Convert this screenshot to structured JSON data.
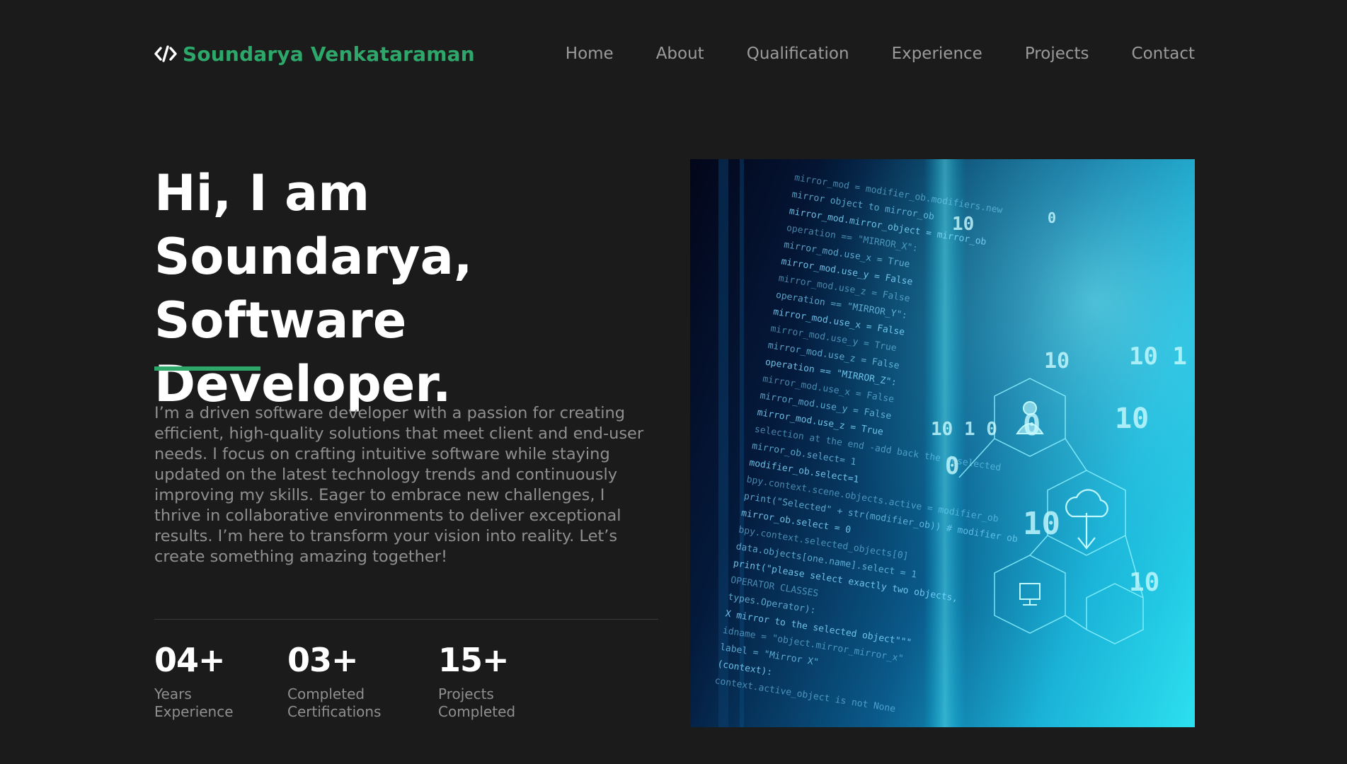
{
  "header": {
    "logo_icon": "code-brackets-icon",
    "logo_text": "Soundarya Venkataraman",
    "nav": [
      {
        "label": "Home"
      },
      {
        "label": "About"
      },
      {
        "label": "Qualification"
      },
      {
        "label": "Experience"
      },
      {
        "label": "Projects"
      },
      {
        "label": "Contact"
      }
    ]
  },
  "hero": {
    "title_lines": [
      "Hi, I am Soundarya,",
      "Software",
      "Developer."
    ],
    "description": "I’m a driven software developer with a passion for creating efficient, high-quality solutions that meet client and end-user needs. I focus on crafting intuitive software while staying updated on the latest technology trends and continuously improving my skills. Eager to embrace new challenges, I thrive in collaborative environments to deliver exceptional results. I’m here to transform your vision into reality. Let’s create something amazing together!",
    "stats": [
      {
        "number": "04+",
        "label_lines": [
          "Years",
          "Experience"
        ]
      },
      {
        "number": "03+",
        "label_lines": [
          "Completed",
          "Certifications"
        ]
      },
      {
        "number": "15+",
        "label_lines": [
          "Projects",
          "Completed"
        ]
      }
    ],
    "image": {
      "code_lines": [
        "mirror_mod = modifier_ob.modifiers.new",
        "mirror object to mirror_ob",
        "mirror_mod.mirror_object = mirror_ob",
        "operation == \"MIRROR_X\":",
        "mirror_mod.use_x = True",
        "mirror_mod.use_y = False",
        "mirror_mod.use_z = False",
        "operation == \"MIRROR_Y\":",
        "mirror_mod.use_x = False",
        "mirror_mod.use_y = True",
        "mirror_mod.use_z = False",
        "operation == \"MIRROR_Z\":",
        "mirror_mod.use_x = False",
        "mirror_mod.use_y = False",
        "mirror_mod.use_z = True",
        "selection at the end -add back the deselected",
        "mirror_ob.select= 1",
        "modifier_ob.select=1",
        "bpy.context.scene.objects.active = modifier_ob",
        "print(\"Selected\" + str(modifier_ob)) # modifier ob",
        "mirror_ob.select = 0",
        "bpy.context.selected_objects[0]",
        "data.objects[one.name].select = 1",
        "print(\"please select exactly two objects,",
        "OPERATOR CLASSES",
        "types.Operator):",
        "X mirror to the selected object\"\"\"",
        "idname = \"object.mirror_mirror_x\"",
        "label = \"Mirror X\"",
        "(context):",
        "context.active_object is not None"
      ],
      "binary_glyphs": [
        "10",
        "0",
        "10",
        "10 1 0",
        "10 1 0",
        "0",
        "10",
        "0",
        "10",
        "10"
      ],
      "network_icons": [
        "user-icon",
        "cloud-download-icon",
        "monitor-icon"
      ]
    }
  },
  "colors": {
    "background": "#1b1b1b",
    "accent": "#2ea86a",
    "text_primary": "#ffffff",
    "text_muted": "#8f8f8f",
    "nav_text": "#9b9b9b"
  }
}
